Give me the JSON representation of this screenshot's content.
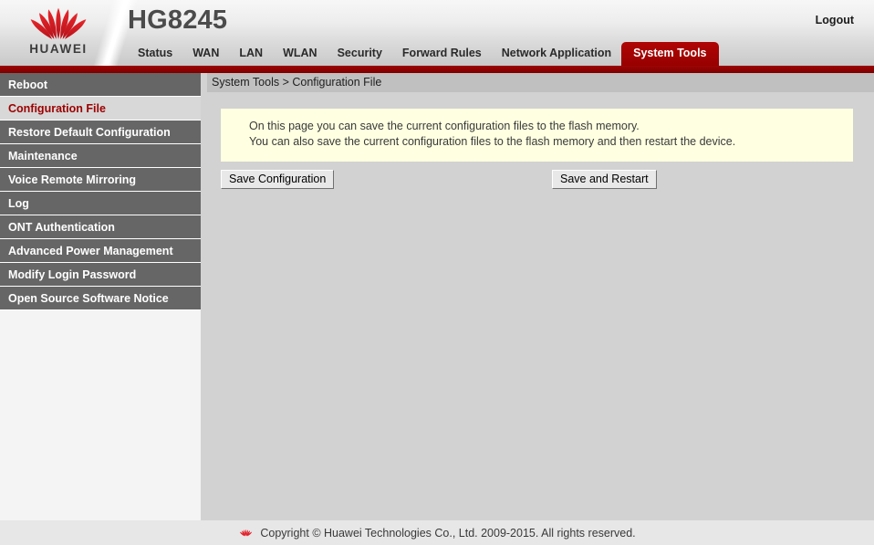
{
  "header": {
    "product_title": "HG8245",
    "logo_word": "HUAWEI",
    "logo_icon": "huawei-flower-logo",
    "logout_label": "Logout",
    "brand_red": "#9c0000",
    "accent_red": "#8f0000"
  },
  "nav": {
    "tabs": [
      {
        "label": "Status",
        "active": false
      },
      {
        "label": "WAN",
        "active": false
      },
      {
        "label": "LAN",
        "active": false
      },
      {
        "label": "WLAN",
        "active": false
      },
      {
        "label": "Security",
        "active": false
      },
      {
        "label": "Forward Rules",
        "active": false
      },
      {
        "label": "Network Application",
        "active": false
      },
      {
        "label": "System Tools",
        "active": true
      }
    ]
  },
  "sidebar": {
    "items": [
      {
        "label": "Reboot",
        "active": false
      },
      {
        "label": "Configuration File",
        "active": true
      },
      {
        "label": "Restore Default Configuration",
        "active": false
      },
      {
        "label": "Maintenance",
        "active": false
      },
      {
        "label": "Voice Remote Mirroring",
        "active": false
      },
      {
        "label": "Log",
        "active": false
      },
      {
        "label": "ONT Authentication",
        "active": false
      },
      {
        "label": "Advanced Power Management",
        "active": false
      },
      {
        "label": "Modify Login Password",
        "active": false
      },
      {
        "label": "Open Source Software Notice",
        "active": false
      }
    ]
  },
  "main": {
    "breadcrumb": "System Tools > Configuration File",
    "info": {
      "line1": "On this page you can save the current configuration files to the flash memory.",
      "line2": "You can also save the current configuration files to the flash memory and then restart the device.",
      "background": "#ffffe1"
    },
    "buttons": {
      "save_configuration": "Save Configuration",
      "save_and_restart": "Save and Restart"
    }
  },
  "footer": {
    "logo_icon": "huawei-flower-logo-small",
    "copyright": "Copyright © Huawei Technologies Co., Ltd. 2009-2015. All rights reserved."
  }
}
